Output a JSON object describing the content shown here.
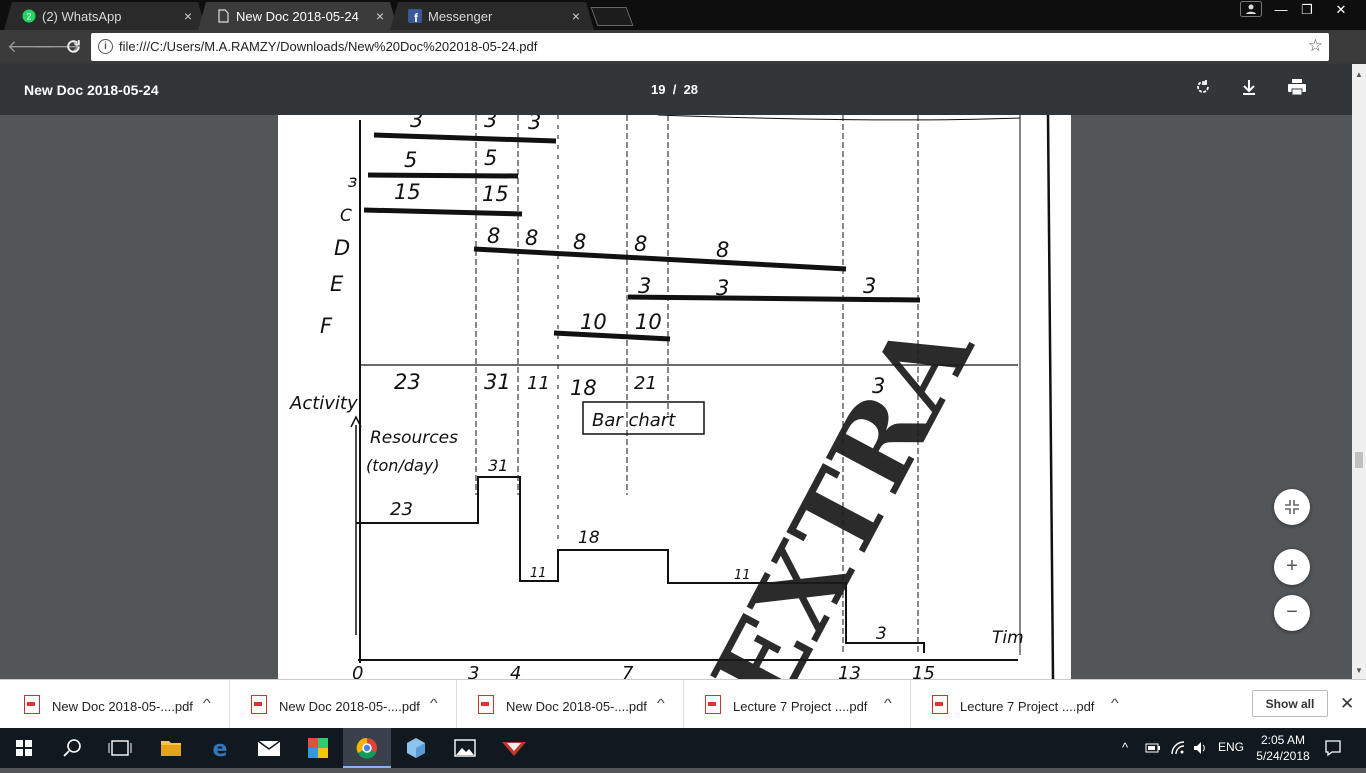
{
  "tabs": [
    {
      "title": "(2) WhatsApp",
      "icon": "whatsapp-icon"
    },
    {
      "title": "New Doc 2018-05-24",
      "icon": "document-icon"
    },
    {
      "title": "Messenger",
      "icon": "facebook-icon"
    }
  ],
  "tab_close": "×",
  "window_controls": {
    "minimize": "—",
    "restore": "❐",
    "close": "✕"
  },
  "address": {
    "url": "file:///C:/Users/M.A.RAMZY/Downloads/New%20Doc%202018-05-24.pdf"
  },
  "pdf": {
    "title": "New Doc 2018-05-24",
    "page_current": "19",
    "page_separator": "/",
    "page_total": "28"
  },
  "scan": {
    "rows_top": [
      [
        "3",
        "3",
        "3"
      ],
      [
        "5",
        "5"
      ],
      [
        "15",
        "15"
      ]
    ],
    "row_labels": [
      "ɜ",
      "C",
      "D",
      "E",
      "F"
    ],
    "d_values": [
      "8",
      "8",
      "8",
      "8",
      "8"
    ],
    "e_values": [
      "3",
      "3",
      "3"
    ],
    "f_values": [
      "10",
      "10"
    ],
    "totals": [
      "23",
      "31",
      "11",
      "18",
      "21",
      "3"
    ],
    "activity_label": "Activity",
    "bar_chart_label": "Bar chart",
    "resources_label": "Resources",
    "units_label": "(ton/day)",
    "histogram_values": [
      "31",
      "23",
      "18",
      "11",
      "11",
      "3"
    ],
    "time_label": "Tim",
    "axis_ticks": [
      "0",
      "3",
      "4",
      "7",
      "13",
      "15"
    ],
    "watermark": "EXTRA"
  },
  "downloads": [
    {
      "name": "New Doc 2018-05-....pdf"
    },
    {
      "name": "New Doc 2018-05-....pdf"
    },
    {
      "name": "New Doc 2018-05-....pdf"
    },
    {
      "name": "Lecture 7 Project ....pdf"
    },
    {
      "name": "Lecture 7 Project ....pdf"
    }
  ],
  "show_all": "Show all",
  "tray": {
    "language": "ENG",
    "time": "2:05 AM",
    "date": "5/24/2018"
  }
}
